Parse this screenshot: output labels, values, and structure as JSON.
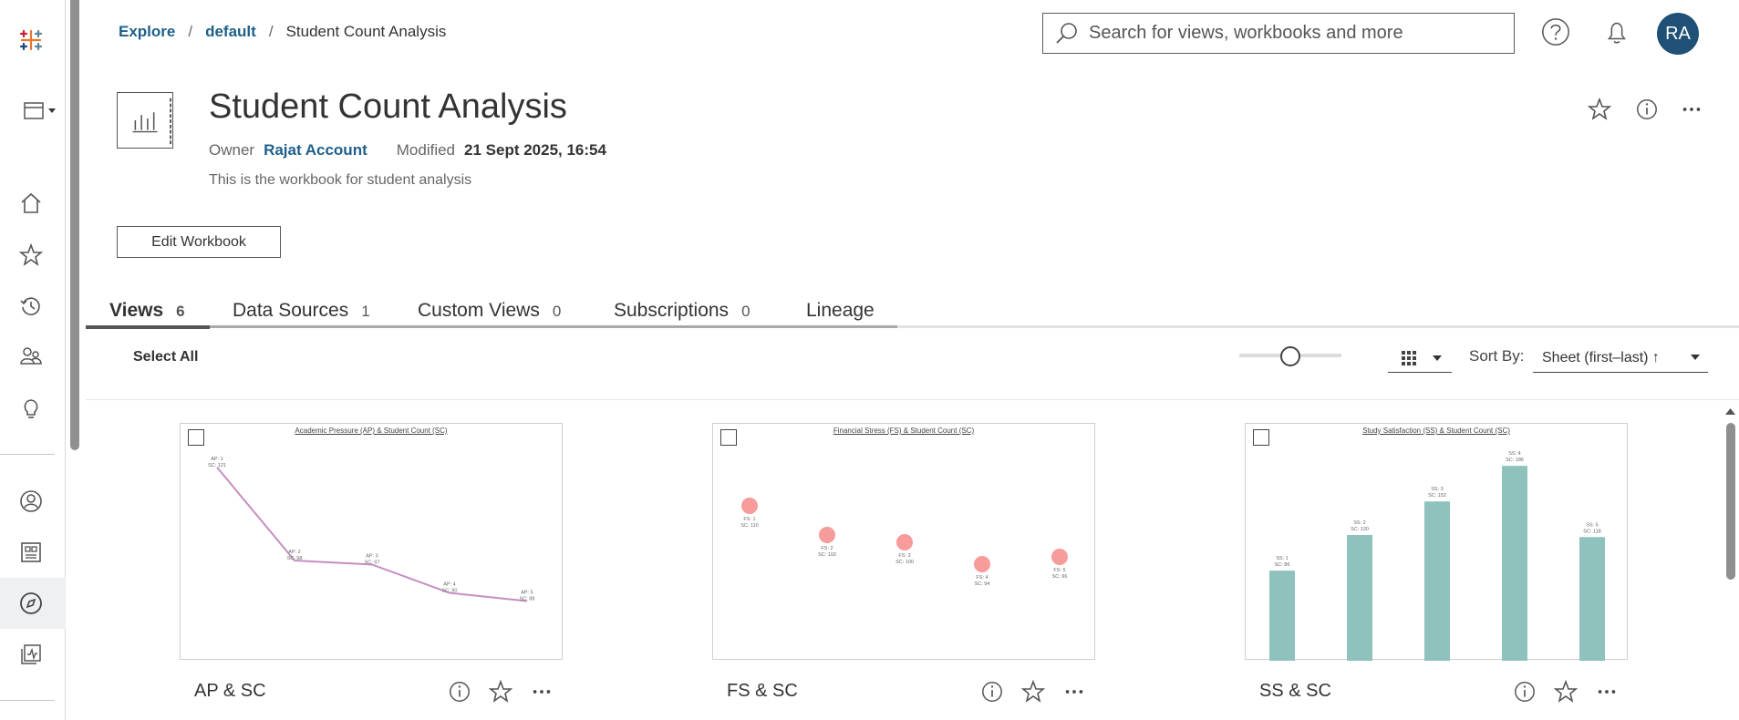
{
  "breadcrumb": {
    "explore": "Explore",
    "default": "default",
    "current": "Student Count Analysis",
    "sep": "/"
  },
  "search": {
    "placeholder": "Search for views, workbooks and more"
  },
  "user": {
    "initials": "RA"
  },
  "workbook": {
    "title": "Student Count Analysis",
    "owner_label": "Owner",
    "owner": "Rajat Account",
    "modified_label": "Modified",
    "modified": "21 Sept 2025, 16:54",
    "description": "This is the workbook for student analysis",
    "edit_label": "Edit Workbook"
  },
  "tabs": [
    {
      "label": "Views",
      "count": "6"
    },
    {
      "label": "Data Sources",
      "count": "1"
    },
    {
      "label": "Custom Views",
      "count": "0"
    },
    {
      "label": "Subscriptions",
      "count": "0"
    },
    {
      "label": "Lineage",
      "count": ""
    }
  ],
  "toolbar": {
    "select_all": "Select All",
    "sort_label": "Sort By:",
    "sort_value": "Sheet (first–last) ↑",
    "zoom_fraction": 0.5
  },
  "cards": [
    {
      "name": "AP & SC",
      "chart_title": "Academic Pressure (AP) & Student Count (SC)",
      "chart_data": {
        "type": "line",
        "categories": [
          "AP: 1",
          "AP: 2",
          "AP: 3",
          "AP: 4",
          "AP: 5"
        ],
        "values": [
          121,
          98,
          97,
          90,
          88
        ]
      }
    },
    {
      "name": "FS & SC",
      "chart_title": "Financial Stress (FS) & Student Count (SC)",
      "chart_data": {
        "type": "scatter",
        "categories": [
          "FS: 1",
          "FS: 2",
          "FS: 3",
          "FS: 4",
          "FS: 5"
        ],
        "values": [
          110,
          102,
          100,
          94,
          96
        ]
      }
    },
    {
      "name": "SS & SC",
      "chart_title": "Study Satisfaction (SS) & Student Count (SC)",
      "chart_data": {
        "type": "bar",
        "categories": [
          "SS: 1",
          "SS: 2",
          "SS: 3",
          "SS: 4",
          "SS: 5"
        ],
        "values": [
          86,
          120,
          152,
          186,
          118
        ]
      }
    }
  ],
  "colors": {
    "accent": "#1f5f8b",
    "avatar": "#1f5075",
    "line": "#c58fc1",
    "dot": "#f79b9b",
    "bar": "#8fc2bd"
  }
}
